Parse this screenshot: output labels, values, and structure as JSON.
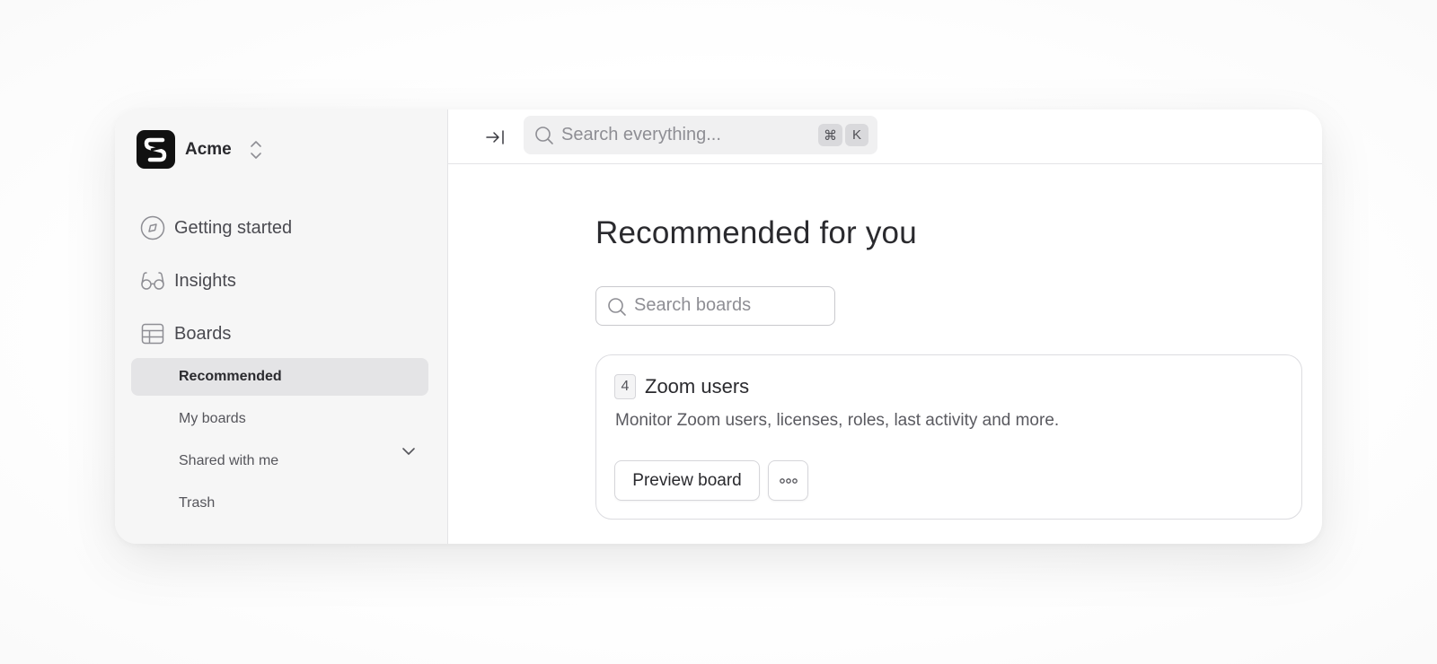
{
  "sidebar": {
    "workspace": {
      "name": "Acme",
      "logo_icon": "brand-logo-icon",
      "switcher_icon": "chevron-up-down-icon"
    },
    "nav": [
      {
        "label": "Getting started",
        "icon": "compass-icon"
      },
      {
        "label": "Insights",
        "icon": "glasses-icon"
      },
      {
        "label": "Boards",
        "icon": "table-icon",
        "expanded": true
      }
    ],
    "boards_sub": [
      {
        "label": "Recommended",
        "active": true
      },
      {
        "label": "My boards",
        "active": false
      },
      {
        "label": "Shared with me",
        "active": false
      },
      {
        "label": "Trash",
        "active": false
      }
    ]
  },
  "topbar": {
    "collapse_icon": "arrow-right-to-line-icon",
    "search": {
      "placeholder": "Search everything...",
      "value": "",
      "shortcut_keys": [
        "⌘",
        "K"
      ]
    }
  },
  "main": {
    "title": "Recommended for you",
    "board_search": {
      "placeholder": "Search boards",
      "value": ""
    },
    "cards": [
      {
        "count": "4",
        "title": "Zoom users",
        "description": "Monitor Zoom users, licenses, roles, last activity and more.",
        "primary_action": "Preview board",
        "more_icon": "more-horizontal-icon"
      }
    ]
  },
  "colors": {
    "sidebar_bg": "#f6f6f6",
    "active_item_bg": "#e4e4e6",
    "text_primary": "#2a2a2e",
    "text_muted": "#8e8e94",
    "border": "#dcdce0"
  }
}
